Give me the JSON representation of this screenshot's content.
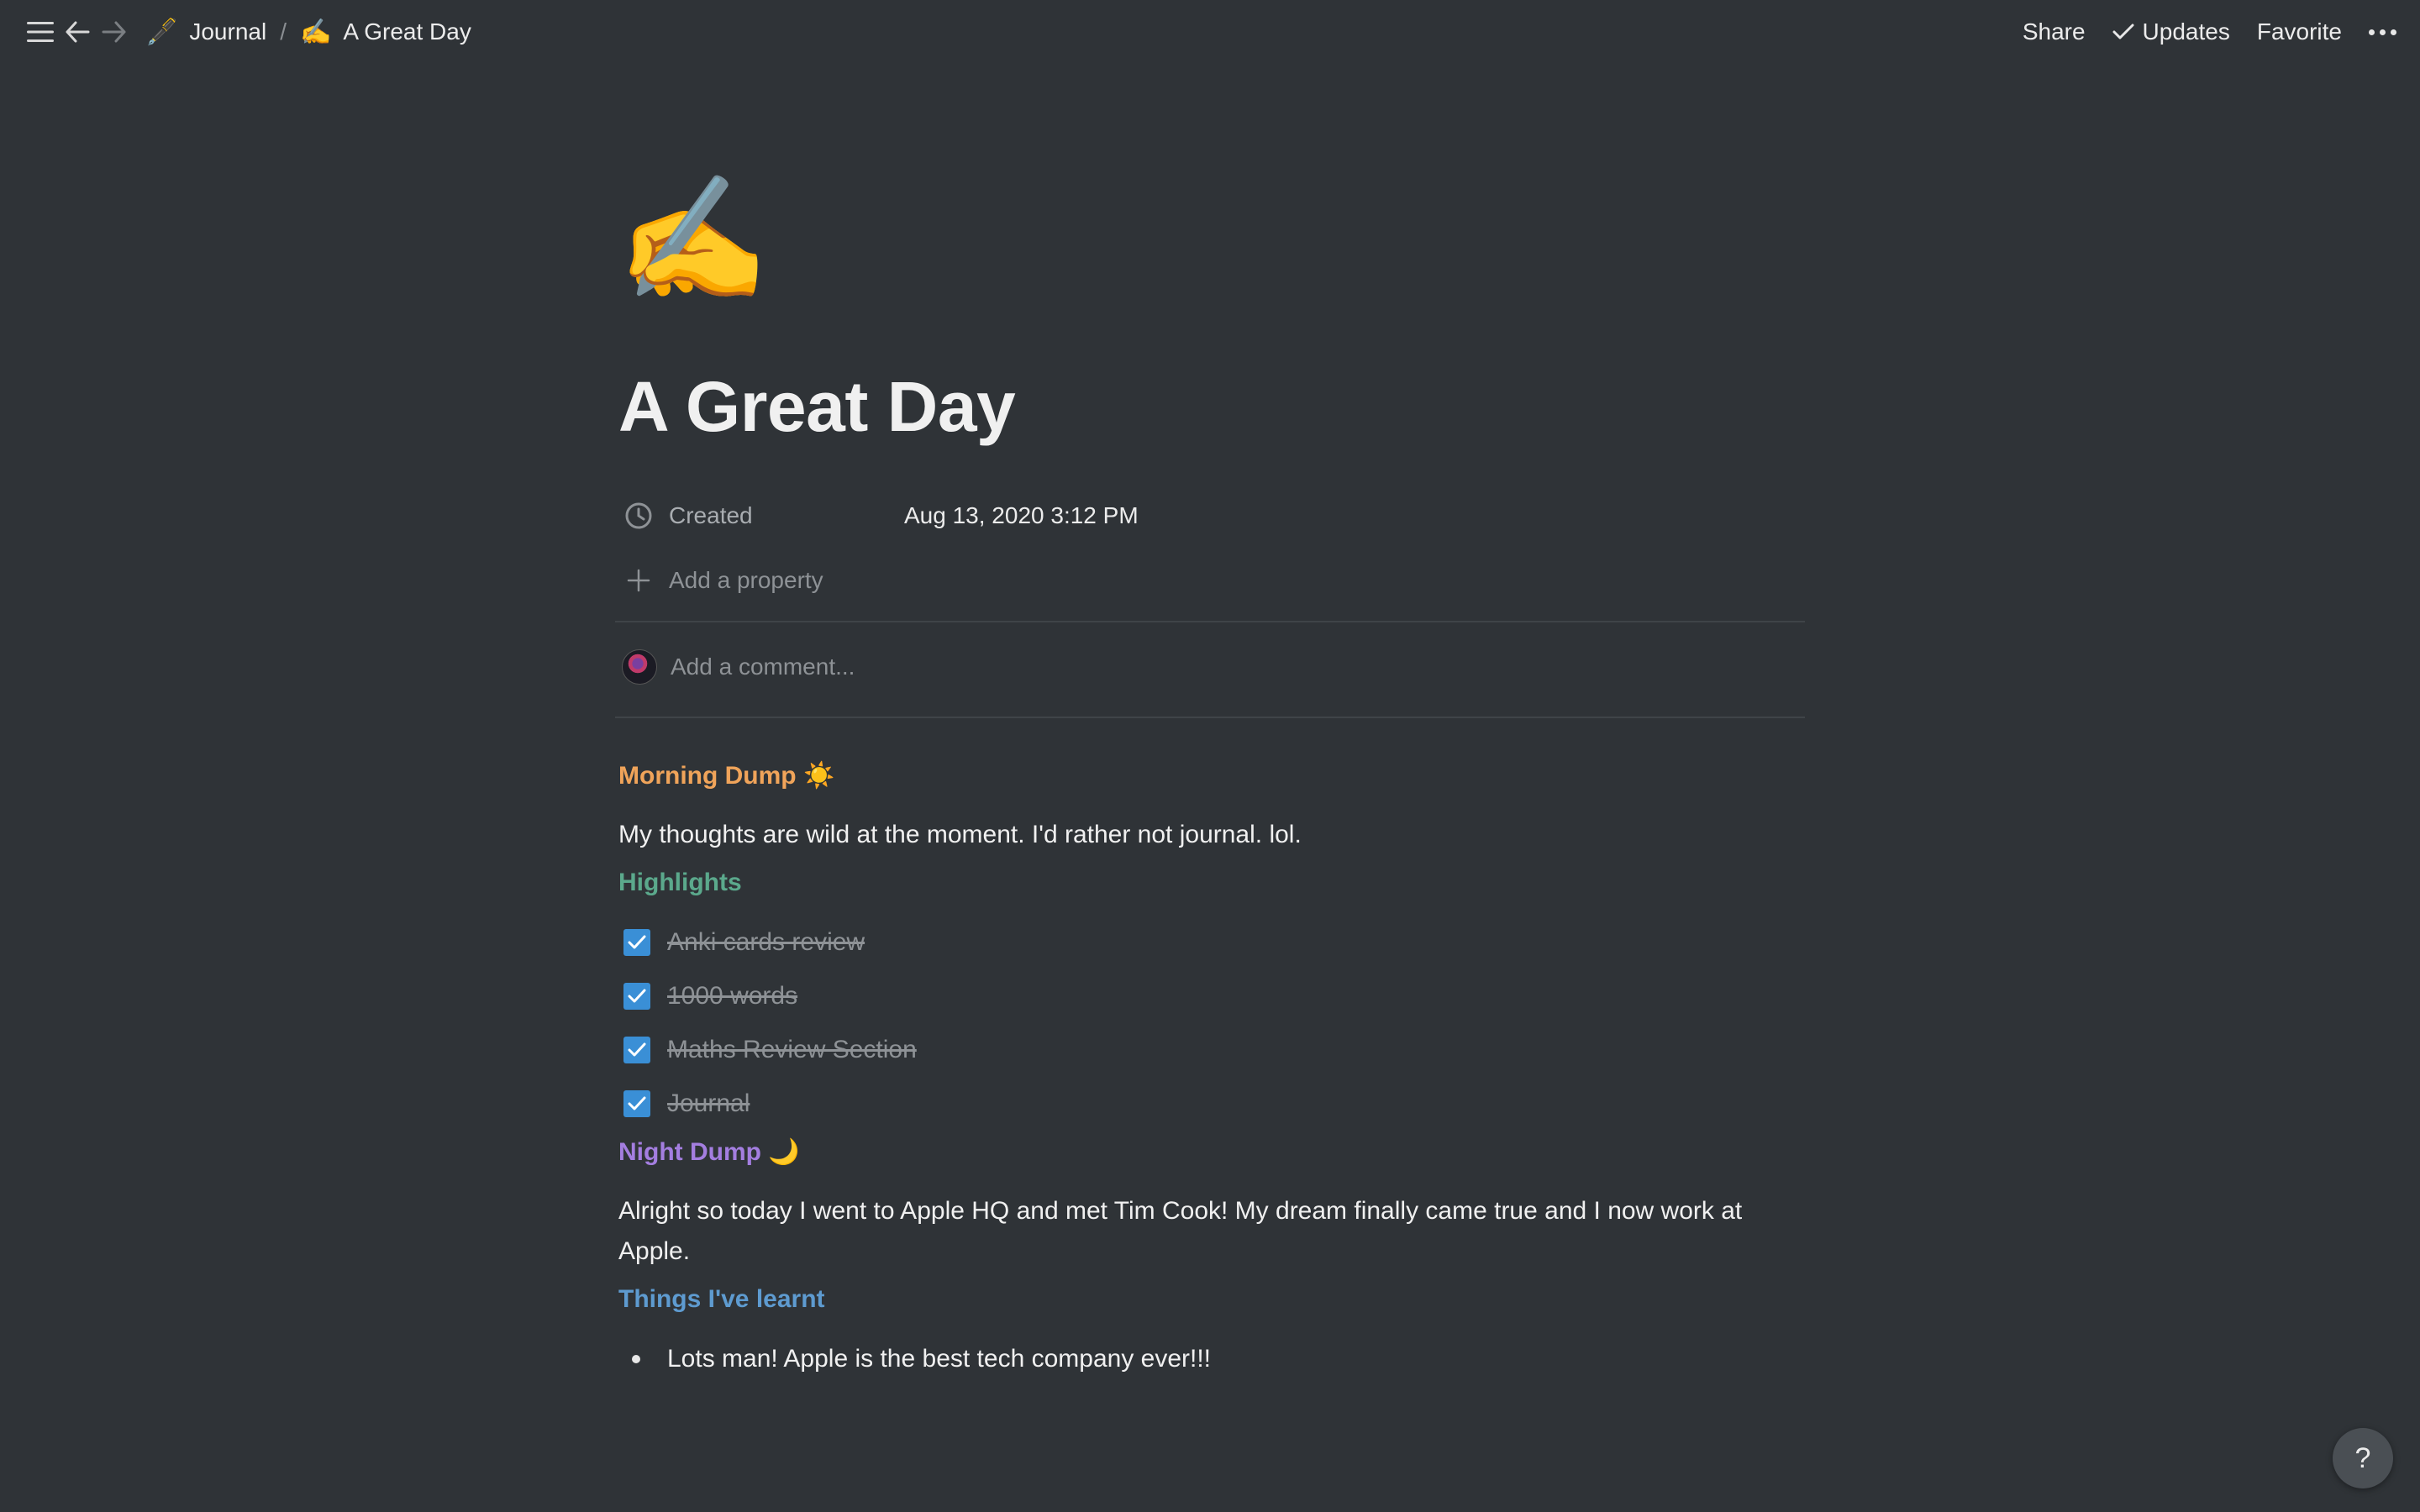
{
  "topbar": {
    "breadcrumb": [
      {
        "emoji": "🖋️",
        "label": "Journal"
      },
      {
        "emoji": "✍️",
        "label": "A Great Day"
      }
    ],
    "separator": "/",
    "share_label": "Share",
    "updates_label": "Updates",
    "favorite_label": "Favorite",
    "icons": [
      "menu-icon",
      "back-arrow-icon",
      "forward-arrow-icon",
      "checkmark-icon",
      "more-options-icon"
    ]
  },
  "page": {
    "icon_emoji": "✍️",
    "title": "A Great Day",
    "properties": [
      {
        "name": "Created",
        "value": "Aug 13, 2020 3:12 PM",
        "icon": "clock-icon"
      }
    ],
    "add_property_label": "Add a property",
    "comment_placeholder": "Add a comment..."
  },
  "content": {
    "morning_heading": "Morning Dump ☀️",
    "morning_text": "My thoughts are wild at the moment. I'd rather not journal. lol.",
    "highlights_heading": "Highlights",
    "todos": [
      {
        "label": "Anki cards review",
        "checked": true
      },
      {
        "label": "1000 words",
        "checked": true
      },
      {
        "label": "Maths Review Section",
        "checked": true
      },
      {
        "label": "Journal",
        "checked": true
      }
    ],
    "night_heading": "Night Dump 🌙",
    "night_text": "Alright so today I went to Apple HQ and met Tim Cook! My dream finally came true and I now work at Apple.",
    "learnt_heading": "Things I've learnt",
    "bullets": [
      "Lots man! Apple is the best tech company ever!!!"
    ]
  },
  "help_label": "?",
  "colors": {
    "background": "#2f3337",
    "morning": "#f0a45a",
    "highlights": "#5ba98c",
    "night": "#a47ee0",
    "learnt": "#5e9bd0",
    "checkbox": "#3a8fd6"
  }
}
